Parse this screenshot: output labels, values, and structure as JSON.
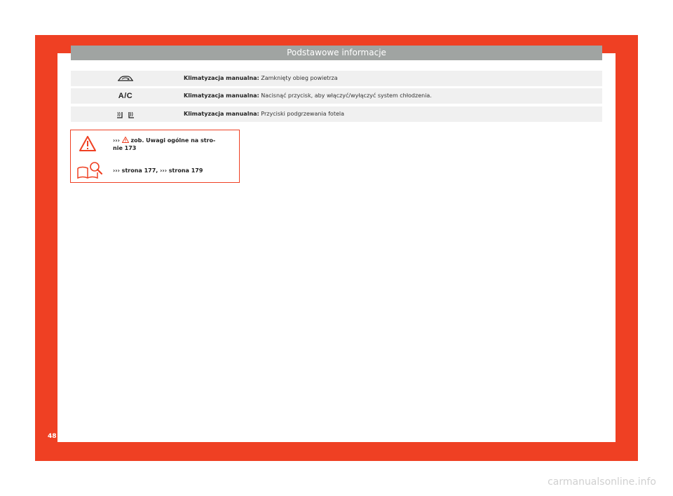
{
  "header": {
    "title": "Podstawowe informacje"
  },
  "rows": [
    {
      "icon": "car-recirculation-icon",
      "label": "Klimatyzacja manualna:",
      "text": " Zamknięty obieg powietrza"
    },
    {
      "icon": "ac-icon",
      "icon_text": "A/C",
      "label": "Klimatyzacja manualna:",
      "text": " Nacisnąć przycisk, aby włączyć/wyłączyć system chłodzenia."
    },
    {
      "icon": "seat-heating-icon",
      "label": "Klimatyzacja manualna:",
      "text": " Przyciski podgrzewania fotela"
    }
  ],
  "note": {
    "arrows1": "›››",
    "warning_text": " zob. Uwagi ogólne na stro-",
    "warning_text2": "nie 173",
    "arrows2": "›››",
    "ref1": " strona 177, ",
    "arrows3": "›››",
    "ref2": " strona 179"
  },
  "page_number": "48",
  "watermark": "carmanualsonline.info",
  "colors": {
    "frame": "#ef4023",
    "header_bg": "#a0a4a2",
    "row_bg": "#f0f0f0"
  }
}
